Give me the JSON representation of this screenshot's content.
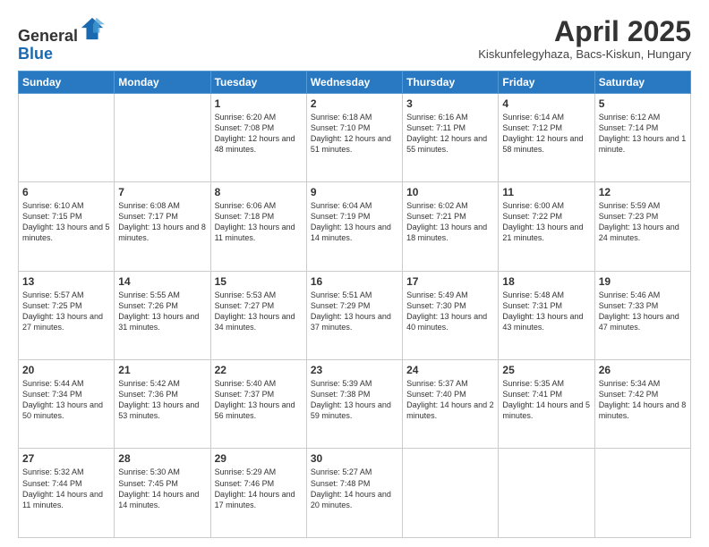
{
  "logo": {
    "line1": "General",
    "line2": "Blue"
  },
  "title": "April 2025",
  "location": "Kiskunfelegyhaza, Bacs-Kiskun, Hungary",
  "days_header": [
    "Sunday",
    "Monday",
    "Tuesday",
    "Wednesday",
    "Thursday",
    "Friday",
    "Saturday"
  ],
  "weeks": [
    [
      {
        "day": "",
        "info": ""
      },
      {
        "day": "",
        "info": ""
      },
      {
        "day": "1",
        "info": "Sunrise: 6:20 AM\nSunset: 7:08 PM\nDaylight: 12 hours\nand 48 minutes."
      },
      {
        "day": "2",
        "info": "Sunrise: 6:18 AM\nSunset: 7:10 PM\nDaylight: 12 hours\nand 51 minutes."
      },
      {
        "day": "3",
        "info": "Sunrise: 6:16 AM\nSunset: 7:11 PM\nDaylight: 12 hours\nand 55 minutes."
      },
      {
        "day": "4",
        "info": "Sunrise: 6:14 AM\nSunset: 7:12 PM\nDaylight: 12 hours\nand 58 minutes."
      },
      {
        "day": "5",
        "info": "Sunrise: 6:12 AM\nSunset: 7:14 PM\nDaylight: 13 hours\nand 1 minute."
      }
    ],
    [
      {
        "day": "6",
        "info": "Sunrise: 6:10 AM\nSunset: 7:15 PM\nDaylight: 13 hours\nand 5 minutes."
      },
      {
        "day": "7",
        "info": "Sunrise: 6:08 AM\nSunset: 7:17 PM\nDaylight: 13 hours\nand 8 minutes."
      },
      {
        "day": "8",
        "info": "Sunrise: 6:06 AM\nSunset: 7:18 PM\nDaylight: 13 hours\nand 11 minutes."
      },
      {
        "day": "9",
        "info": "Sunrise: 6:04 AM\nSunset: 7:19 PM\nDaylight: 13 hours\nand 14 minutes."
      },
      {
        "day": "10",
        "info": "Sunrise: 6:02 AM\nSunset: 7:21 PM\nDaylight: 13 hours\nand 18 minutes."
      },
      {
        "day": "11",
        "info": "Sunrise: 6:00 AM\nSunset: 7:22 PM\nDaylight: 13 hours\nand 21 minutes."
      },
      {
        "day": "12",
        "info": "Sunrise: 5:59 AM\nSunset: 7:23 PM\nDaylight: 13 hours\nand 24 minutes."
      }
    ],
    [
      {
        "day": "13",
        "info": "Sunrise: 5:57 AM\nSunset: 7:25 PM\nDaylight: 13 hours\nand 27 minutes."
      },
      {
        "day": "14",
        "info": "Sunrise: 5:55 AM\nSunset: 7:26 PM\nDaylight: 13 hours\nand 31 minutes."
      },
      {
        "day": "15",
        "info": "Sunrise: 5:53 AM\nSunset: 7:27 PM\nDaylight: 13 hours\nand 34 minutes."
      },
      {
        "day": "16",
        "info": "Sunrise: 5:51 AM\nSunset: 7:29 PM\nDaylight: 13 hours\nand 37 minutes."
      },
      {
        "day": "17",
        "info": "Sunrise: 5:49 AM\nSunset: 7:30 PM\nDaylight: 13 hours\nand 40 minutes."
      },
      {
        "day": "18",
        "info": "Sunrise: 5:48 AM\nSunset: 7:31 PM\nDaylight: 13 hours\nand 43 minutes."
      },
      {
        "day": "19",
        "info": "Sunrise: 5:46 AM\nSunset: 7:33 PM\nDaylight: 13 hours\nand 47 minutes."
      }
    ],
    [
      {
        "day": "20",
        "info": "Sunrise: 5:44 AM\nSunset: 7:34 PM\nDaylight: 13 hours\nand 50 minutes."
      },
      {
        "day": "21",
        "info": "Sunrise: 5:42 AM\nSunset: 7:36 PM\nDaylight: 13 hours\nand 53 minutes."
      },
      {
        "day": "22",
        "info": "Sunrise: 5:40 AM\nSunset: 7:37 PM\nDaylight: 13 hours\nand 56 minutes."
      },
      {
        "day": "23",
        "info": "Sunrise: 5:39 AM\nSunset: 7:38 PM\nDaylight: 13 hours\nand 59 minutes."
      },
      {
        "day": "24",
        "info": "Sunrise: 5:37 AM\nSunset: 7:40 PM\nDaylight: 14 hours\nand 2 minutes."
      },
      {
        "day": "25",
        "info": "Sunrise: 5:35 AM\nSunset: 7:41 PM\nDaylight: 14 hours\nand 5 minutes."
      },
      {
        "day": "26",
        "info": "Sunrise: 5:34 AM\nSunset: 7:42 PM\nDaylight: 14 hours\nand 8 minutes."
      }
    ],
    [
      {
        "day": "27",
        "info": "Sunrise: 5:32 AM\nSunset: 7:44 PM\nDaylight: 14 hours\nand 11 minutes."
      },
      {
        "day": "28",
        "info": "Sunrise: 5:30 AM\nSunset: 7:45 PM\nDaylight: 14 hours\nand 14 minutes."
      },
      {
        "day": "29",
        "info": "Sunrise: 5:29 AM\nSunset: 7:46 PM\nDaylight: 14 hours\nand 17 minutes."
      },
      {
        "day": "30",
        "info": "Sunrise: 5:27 AM\nSunset: 7:48 PM\nDaylight: 14 hours\nand 20 minutes."
      },
      {
        "day": "",
        "info": ""
      },
      {
        "day": "",
        "info": ""
      },
      {
        "day": "",
        "info": ""
      }
    ]
  ]
}
